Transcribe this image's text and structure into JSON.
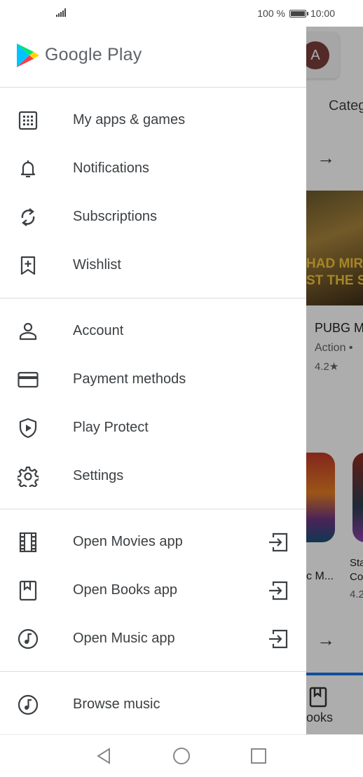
{
  "status_bar": {
    "battery": "100 %",
    "time": "10:00",
    "battery_level": 1.0
  },
  "drawer": {
    "brand": "Google Play",
    "sections": [
      [
        {
          "label": "My apps & games",
          "icon": "apps-grid-icon"
        },
        {
          "label": "Notifications",
          "icon": "bell-icon"
        },
        {
          "label": "Subscriptions",
          "icon": "refresh-icon"
        },
        {
          "label": "Wishlist",
          "icon": "bookmark-add-icon"
        }
      ],
      [
        {
          "label": "Account",
          "icon": "person-icon"
        },
        {
          "label": "Payment methods",
          "icon": "credit-card-icon"
        },
        {
          "label": "Play Protect",
          "icon": "shield-play-icon"
        },
        {
          "label": "Settings",
          "icon": "gear-icon"
        }
      ],
      [
        {
          "label": "Open Movies app",
          "icon": "film-icon",
          "trailing": "open-app-icon"
        },
        {
          "label": "Open Books app",
          "icon": "book-icon",
          "trailing": "open-app-icon"
        },
        {
          "label": "Open Music app",
          "icon": "music-icon",
          "trailing": "open-app-icon"
        }
      ],
      [
        {
          "label": "Browse music",
          "icon": "music-icon"
        }
      ]
    ]
  },
  "background": {
    "avatar_letter": "A",
    "categories_tab": "Categ",
    "banner_text_1": "HAD MIRAM",
    "banner_text_2": "ST THE SA",
    "featured_title": "PUBG M",
    "featured_genre": "Action  •",
    "featured_rating": "4.2★",
    "game_name_1": "c M...",
    "game_name_2a": "Sta",
    "game_name_2b": "Co",
    "game_rating_2": "4.2",
    "bottom_tab": "ooks"
  },
  "colors": {
    "accent": "#1a73e8",
    "icon": "#3c4043",
    "divider": "#dadce0"
  }
}
